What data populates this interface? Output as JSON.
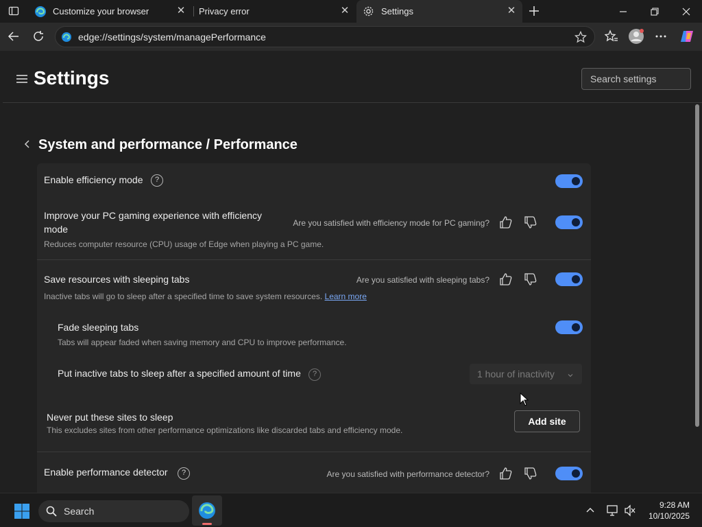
{
  "browser": {
    "tabs": [
      {
        "label": "Customize your browser",
        "icon": "edge-logo-icon",
        "active": false
      },
      {
        "label": "Privacy error",
        "icon": "none",
        "active": false
      },
      {
        "label": "Settings",
        "icon": "gear-icon",
        "active": true
      }
    ],
    "new_tab_icon": "plus-icon",
    "address": "edge://settings/system/managePerformance",
    "window_controls": [
      "minimize-icon",
      "restore-icon",
      "close-icon"
    ]
  },
  "settings": {
    "title": "Settings",
    "search_placeholder": "Search settings",
    "breadcrumb": "System and performance / Performance",
    "rows": {
      "efficiency": {
        "title": "Enable efficiency mode",
        "toggle_on": true
      },
      "gaming": {
        "title_line1": "Improve your PC gaming experience with efficiency",
        "title_line2": "mode",
        "description": "Reduces computer resource (CPU) usage of Edge when playing a PC game.",
        "feedback": "Are you satisfied with efficiency mode for PC gaming?",
        "toggle_on": true
      },
      "sleeping_tabs": {
        "title": "Save resources with sleeping tabs",
        "description": "Inactive tabs will go to sleep after a specified time to save system resources.",
        "learn_more": "Learn more",
        "feedback": "Are you satisfied with sleeping tabs?",
        "toggle_on": true
      },
      "fade": {
        "title": "Fade sleeping tabs",
        "description": "Tabs will appear faded when saving memory and CPU to improve performance.",
        "toggle_on": true
      },
      "sleep_timer": {
        "title": "Put inactive tabs to sleep after a specified amount of time",
        "selected": "1 hour of inactivity"
      },
      "never_sleep": {
        "title": "Never put these sites to sleep",
        "description": "This excludes sites from other performance optimizations like discarded tabs and efficiency mode.",
        "button": "Add site"
      },
      "detector": {
        "title": "Enable performance detector",
        "feedback": "Are you satisfied with performance detector?",
        "toggle_on": true
      }
    }
  },
  "taskbar": {
    "search_label": "Search",
    "time": "9:28 AM",
    "date": "10/10/2025"
  },
  "colors": {
    "accent": "#4f8ef7",
    "link": "#7aa8f5",
    "background": "#202020"
  }
}
